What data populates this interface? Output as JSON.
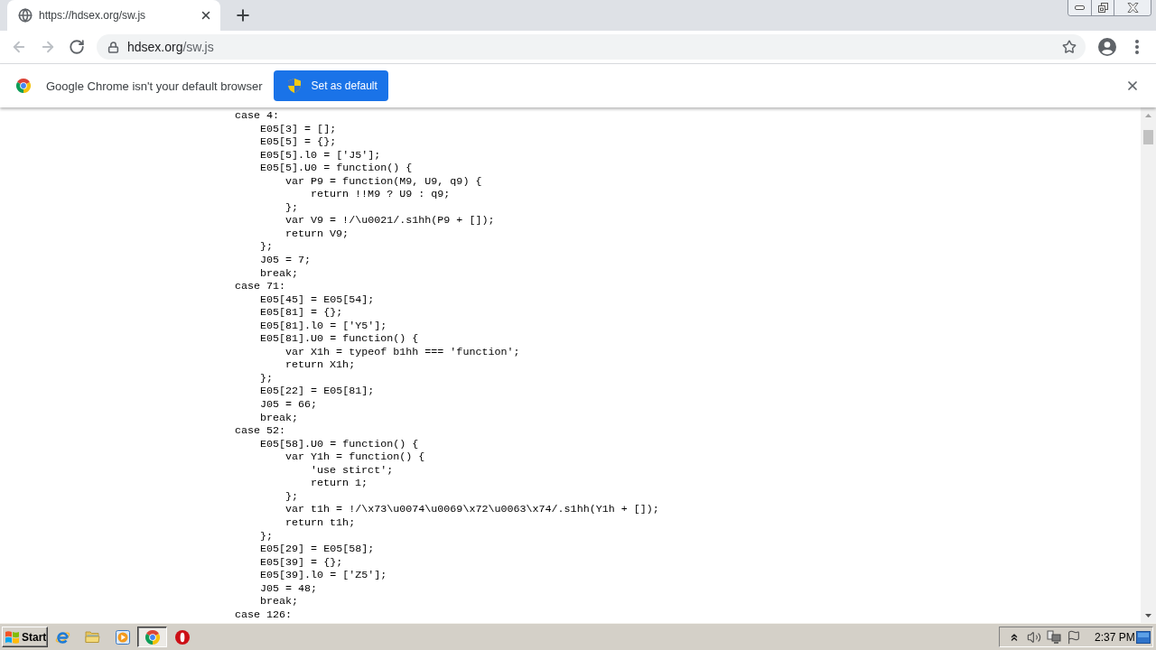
{
  "tabs": [
    {
      "title": "https://hdsex.org/sw.js",
      "selected": true
    }
  ],
  "toolbar": {
    "nav_buttons": [
      {
        "kind": "back",
        "disabled": true
      },
      {
        "kind": "forward",
        "disabled": true
      },
      {
        "kind": "reload",
        "disabled": false
      }
    ],
    "address": {
      "host": "hdsex.org",
      "path": "/sw.js"
    }
  },
  "infobar": {
    "message": "Google Chrome isn't your default browser",
    "button": "Set as default"
  },
  "code": [
    {
      "text": "case 4:",
      "children": [
        {
          "text": "E05[3] = [];"
        },
        {
          "text": "E05[5] = {};"
        },
        {
          "text": "E05[5].l0 = ['J5'];"
        },
        {
          "text": "E05[5].U0 = function() {",
          "children": [
            {
              "text": "var P9 = function(M9, U9, q9) {",
              "children": [
                {
                  "text": "return !!M9 ? U9 : q9;"
                }
              ]
            },
            {
              "text": "};"
            },
            {
              "text": "var V9 = !/\\u0021/.s1hh(P9 + []);"
            },
            {
              "text": "return V9;"
            }
          ]
        },
        {
          "text": "};"
        },
        {
          "text": "J05 = 7;"
        },
        {
          "text": "break;"
        }
      ]
    },
    {
      "text": "case 71:",
      "children": [
        {
          "text": "E05[45] = E05[54];"
        },
        {
          "text": "E05[81] = {};"
        },
        {
          "text": "E05[81].l0 = ['Y5'];"
        },
        {
          "text": "E05[81].U0 = function() {",
          "children": [
            {
              "text": "var X1h = typeof b1hh === 'function';"
            },
            {
              "text": "return X1h;"
            }
          ]
        },
        {
          "text": "};"
        },
        {
          "text": "E05[22] = E05[81];"
        },
        {
          "text": "J05 = 66;"
        },
        {
          "text": "break;"
        }
      ]
    },
    {
      "text": "case 52:",
      "children": [
        {
          "text": "E05[58].U0 = function() {",
          "children": [
            {
              "text": "var Y1h = function() {",
              "children": [
                {
                  "text": "'use stirct';"
                },
                {
                  "text": "return 1;"
                }
              ]
            },
            {
              "text": "};"
            },
            {
              "text": "var t1h = !/\\x73\\u0074\\u0069\\x72\\u0063\\x74/.s1hh(Y1h + []);"
            },
            {
              "text": "return t1h;"
            }
          ]
        },
        {
          "text": "};"
        },
        {
          "text": "E05[29] = E05[58];"
        },
        {
          "text": "E05[39] = {};"
        },
        {
          "text": "E05[39].l0 = ['Z5'];"
        },
        {
          "text": "J05 = 48;"
        },
        {
          "text": "break;"
        }
      ]
    },
    {
      "text": "case 126:"
    }
  ],
  "taskbar": {
    "start": "Start",
    "apps": [
      {
        "kind": "ie",
        "selected": false
      },
      {
        "kind": "folder",
        "selected": false
      },
      {
        "kind": "player",
        "selected": false
      },
      {
        "kind": "chrome",
        "selected": true
      },
      {
        "kind": "opera",
        "selected": false
      }
    ],
    "clock": "2:37 PM"
  }
}
